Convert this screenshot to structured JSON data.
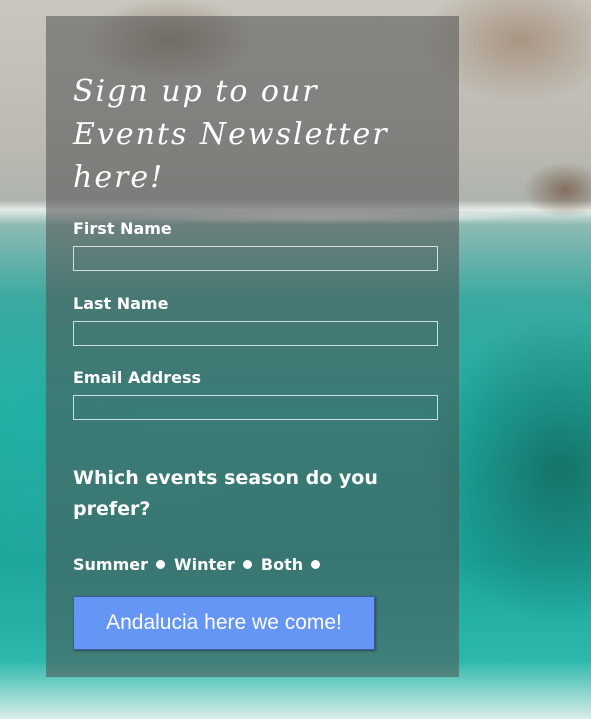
{
  "form": {
    "title": "Sign up to our Events Newsletter here!",
    "fields": [
      {
        "label": "First Name",
        "value": "",
        "placeholder": ""
      },
      {
        "label": "Last Name",
        "value": "",
        "placeholder": ""
      },
      {
        "label": "Email Address",
        "value": "",
        "placeholder": ""
      }
    ],
    "question": "Which events season do you prefer?",
    "options": [
      "Summer",
      "Winter",
      "Both"
    ],
    "submit_label": "Andalucia here we come!"
  },
  "colors": {
    "panel_overlay": "#505050",
    "button_bg": "#6596f5",
    "text": "#ffffff"
  }
}
